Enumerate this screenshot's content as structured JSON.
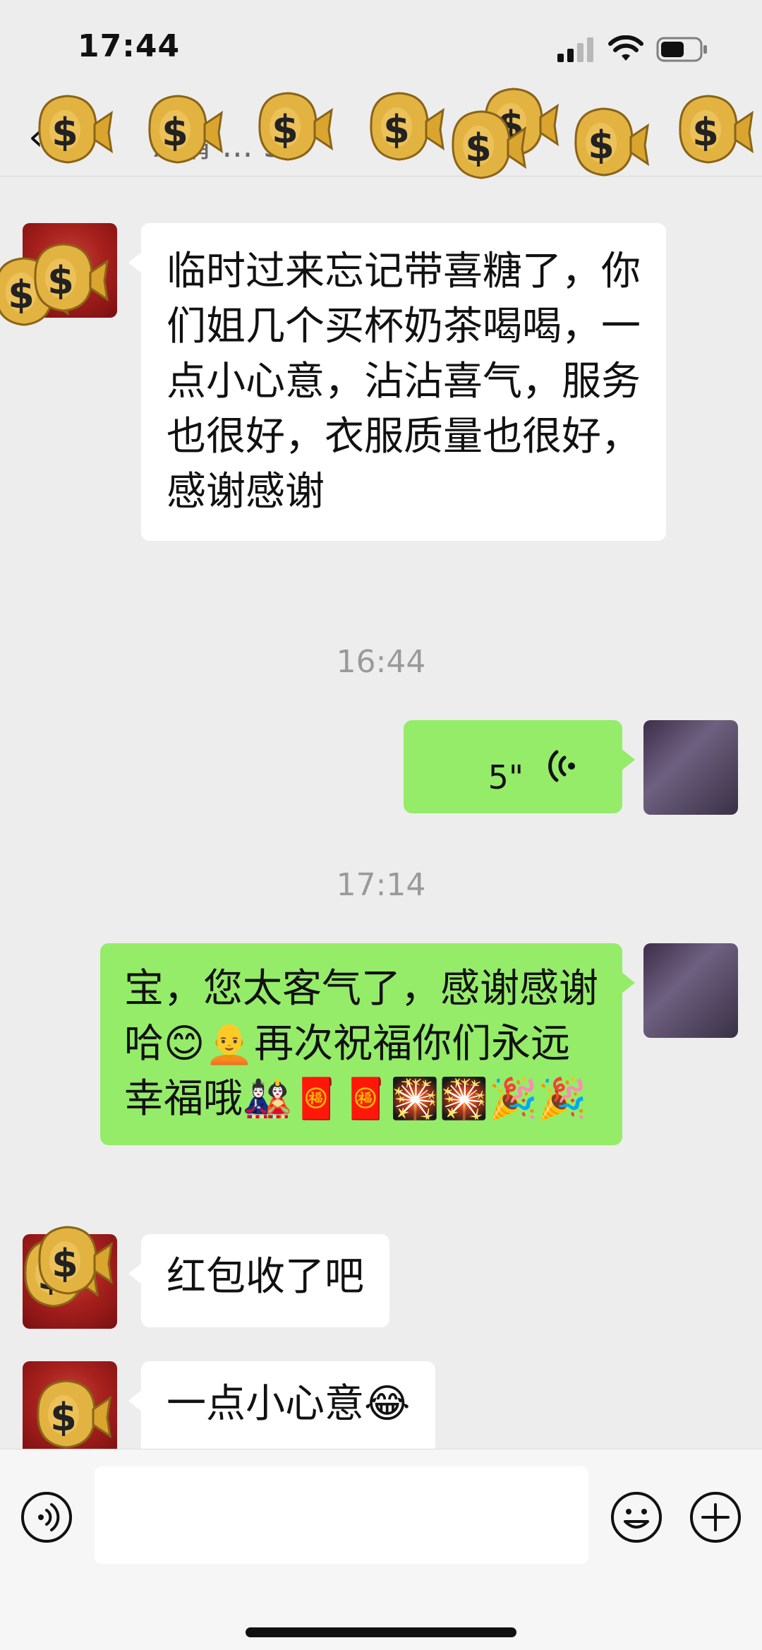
{
  "status_bar": {
    "time": "17:44",
    "icons": [
      "cellular-signal-icon",
      "wifi-icon",
      "battery-icon"
    ]
  },
  "header": {
    "back_icon": "chevron-left-icon",
    "title": "7 请 ... 5"
  },
  "messages": [
    {
      "side": "left",
      "type": "text",
      "text": "临时过来忘记带喜糖了，你们姐几个买杯奶茶喝喝，一点小心意，沾沾喜气，服务也很好，衣服质量也很好，感谢感谢"
    },
    {
      "type": "timestamp",
      "text": "16:44"
    },
    {
      "side": "right",
      "type": "voice",
      "duration": "5\""
    },
    {
      "type": "timestamp",
      "text": "17:14"
    },
    {
      "side": "right",
      "type": "text",
      "text": "宝，您太客气了，感谢感谢哈😊🧑‍🦲再次祝福你们永远幸福哦🎎🧧🧧🎇🎇🎉🎉"
    },
    {
      "side": "left",
      "type": "text",
      "text": "红包收了吧"
    },
    {
      "side": "left",
      "type": "text",
      "text": "一点小心意😂"
    }
  ],
  "input_bar": {
    "voice_icon": "voice-input-icon",
    "emoji_icon": "emoji-icon",
    "plus_icon": "plus-icon"
  },
  "overlay": {
    "effect_icon": "money-bag-icon"
  },
  "colors": {
    "background": "#ededed",
    "bubble_green": "#95ec69",
    "bubble_white": "#ffffff"
  }
}
